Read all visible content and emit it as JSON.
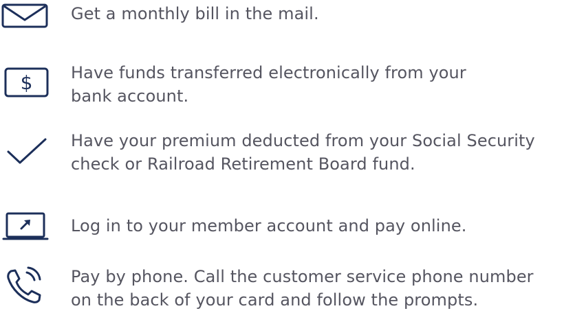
{
  "colors": {
    "icon": "#1c2f5a",
    "text": "#555560"
  },
  "options": [
    {
      "icon": "envelope-icon",
      "lines": [
        "Get a monthly bill in the mail."
      ]
    },
    {
      "icon": "dollar-sign-icon",
      "lines": [
        "Have funds transferred electronically from your",
        "bank account."
      ]
    },
    {
      "icon": "checkmark-icon",
      "lines": [
        "Have your premium deducted from your Social Security",
        "check or Railroad Retirement Board fund."
      ]
    },
    {
      "icon": "laptop-icon",
      "lines": [
        "Log in to your member account and pay online."
      ]
    },
    {
      "icon": "phone-icon",
      "lines": [
        "Pay by phone. Call the customer service phone number",
        "on the back of your card and follow the prompts."
      ]
    }
  ]
}
